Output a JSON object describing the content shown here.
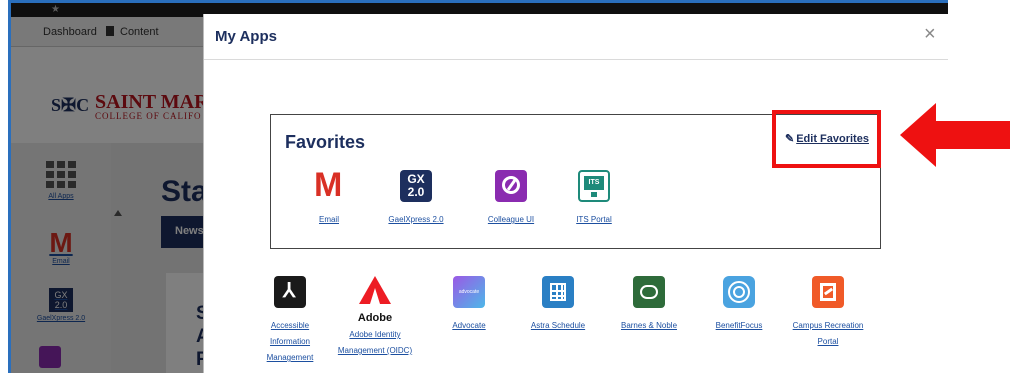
{
  "background": {
    "nav": {
      "dashboard": "Dashboard",
      "content": "Content"
    },
    "logo": {
      "name": "SAINT MARY",
      "subtitle": "COLLEGE OF CALIFO"
    },
    "sidebar": [
      {
        "label": "All Apps",
        "icon": "grid-icon"
      },
      {
        "label": "Email",
        "icon": "gmail-icon"
      },
      {
        "label": "GaelXpress 2.0",
        "icon": "gaelxpress-icon"
      }
    ],
    "heading": "Sta",
    "tab": "News/",
    "card_letters": [
      "S",
      "A",
      "R"
    ]
  },
  "modal": {
    "title": "My Apps",
    "close_glyph": "×",
    "favorites": {
      "title": "Favorites",
      "edit_label": "Edit Favorites",
      "apps": [
        {
          "label": "Email",
          "icon": "gmail-icon"
        },
        {
          "label": "GaelXpress 2.0",
          "icon": "gaelxpress-icon",
          "icon_text": "GX 2.0"
        },
        {
          "label": "Colleague UI",
          "icon": "colleague-icon"
        },
        {
          "label": "ITS Portal",
          "icon": "its-portal-icon",
          "icon_text": "ITS"
        }
      ]
    },
    "all_apps": [
      {
        "label": "Accessible Information Management",
        "icon": "accessible-icon"
      },
      {
        "label": "Adobe Identity Management (OIDC)",
        "icon": "adobe-icon",
        "icon_text": "Adobe"
      },
      {
        "label": "Advocate",
        "icon": "advocate-icon",
        "icon_text": "advocate"
      },
      {
        "label": "Astra Schedule",
        "icon": "astra-icon"
      },
      {
        "label": "Barnes & Noble",
        "icon": "barnes-noble-icon"
      },
      {
        "label": "BenefitFocus",
        "icon": "benefitfocus-icon"
      },
      {
        "label": "Campus Recreation Portal",
        "icon": "campus-recreation-icon"
      }
    ]
  },
  "colors": {
    "navy": "#1d2f5e",
    "highlight": "#ee1111",
    "link": "#1c4fa0"
  }
}
